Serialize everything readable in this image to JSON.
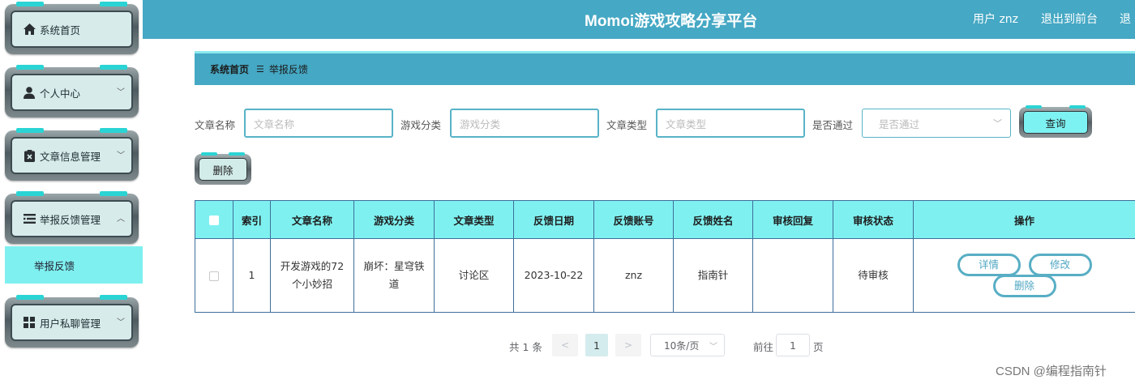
{
  "header": {
    "title": "Momoi游戏攻略分享平台",
    "user": "用户 znz",
    "back_to_front": "退出到前台",
    "logout": "退"
  },
  "sidebar": {
    "items": [
      {
        "label": "系统首页",
        "icon": "home-icon"
      },
      {
        "label": "个人中心",
        "icon": "user-icon",
        "chevron": "﹀"
      },
      {
        "label": "文章信息管理",
        "icon": "clipboard-icon",
        "chevron": "﹀"
      },
      {
        "label": "举报反馈管理",
        "icon": "list-icon",
        "chevron": "︿"
      },
      {
        "label": "用户私聊管理",
        "icon": "grid-icon",
        "chevron": "﹀"
      }
    ],
    "submenu_active": "举报反馈"
  },
  "breadcrumb": {
    "home": "系统首页",
    "separator": "☰",
    "current": "举报反馈"
  },
  "search": {
    "article_name_label": "文章名称",
    "article_name_placeholder": "文章名称",
    "game_category_label": "游戏分类",
    "game_category_placeholder": "游戏分类",
    "article_type_label": "文章类型",
    "article_type_placeholder": "文章类型",
    "approved_label": "是否通过",
    "approved_placeholder": "是否通过",
    "query_button": "查询"
  },
  "actions": {
    "delete_button": "删除"
  },
  "table": {
    "headers": [
      "索引",
      "文章名称",
      "游戏分类",
      "文章类型",
      "反馈日期",
      "反馈账号",
      "反馈姓名",
      "审核回复",
      "审核状态",
      "操作"
    ],
    "rows": [
      {
        "index": "1",
        "article_name": "开发游戏的72个小妙招",
        "game_category": "崩坏：星穹铁道",
        "article_type": "讨论区",
        "feedback_date": "2023-10-22",
        "feedback_account": "znz",
        "feedback_name": "指南针",
        "review_reply": "",
        "review_status": "待审核",
        "op_detail": "详情",
        "op_edit": "修改",
        "op_delete": "删除"
      }
    ]
  },
  "pagination": {
    "total": "共 1 条",
    "prev": "<",
    "current_page": "1",
    "next": ">",
    "page_size": "10条/页",
    "goto_label": "前往",
    "goto_value": "1",
    "page_suffix": "页"
  },
  "watermark": "CSDN @编程指南针",
  "colors": {
    "header": "#45a8c4",
    "accent_cyan": "#7ff0f0",
    "menu_bg": "#d6ebea"
  }
}
